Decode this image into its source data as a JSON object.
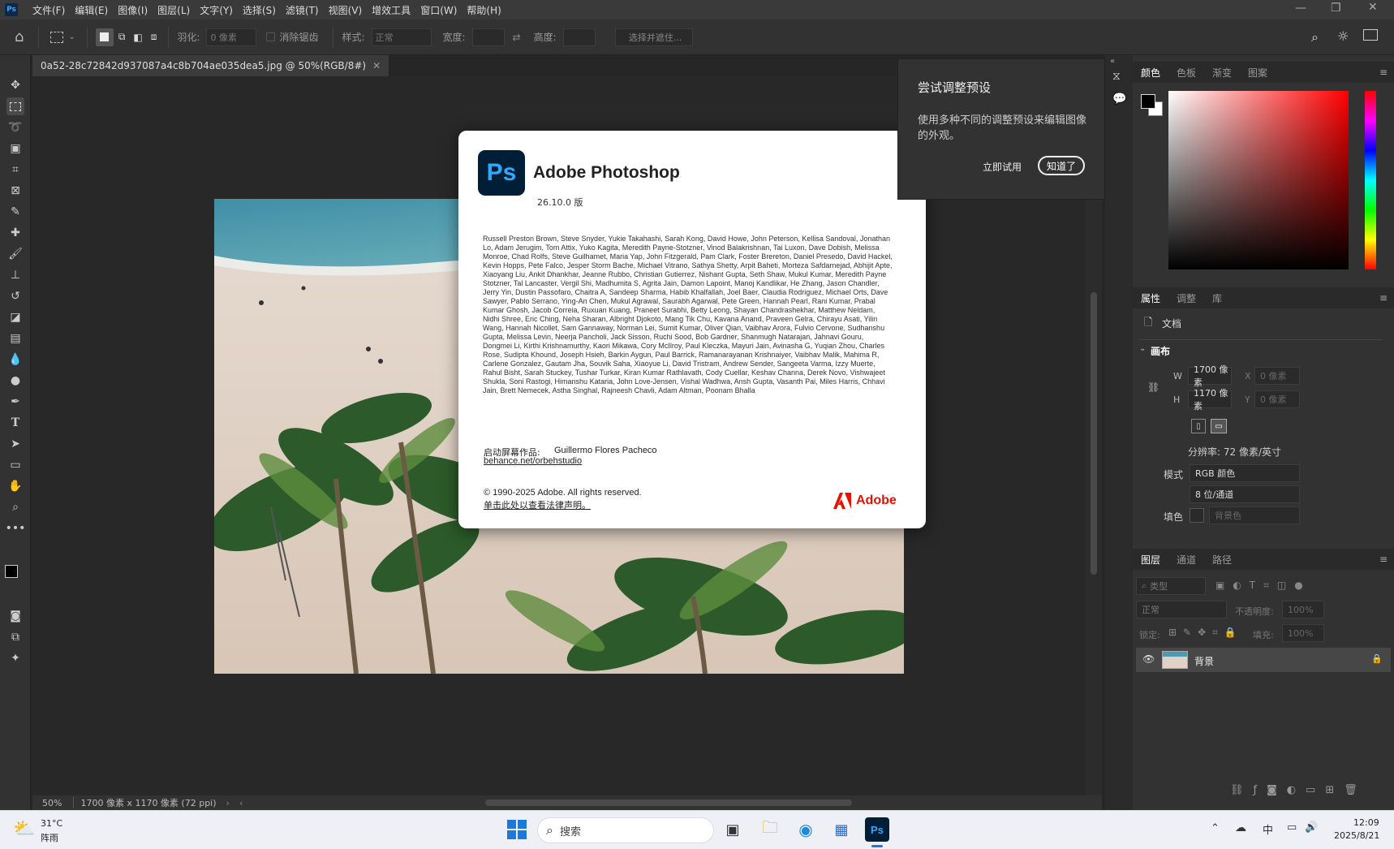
{
  "menubar": {
    "items": [
      "文件(F)",
      "编辑(E)",
      "图像(I)",
      "图层(L)",
      "文字(Y)",
      "选择(S)",
      "滤镜(T)",
      "视图(V)",
      "增效工具",
      "窗口(W)",
      "帮助(H)"
    ]
  },
  "options": {
    "feather_label": "羽化:",
    "feather_value": "0 像素",
    "antialias": "消除锯齿",
    "style_label": "样式:",
    "style_value": "正常",
    "width_label": "宽度:",
    "height_label": "高度:",
    "select_mask": "选择并遮住..."
  },
  "document": {
    "tab_title": "0a52-28c72842d937087a4c8b704ae035dea5.jpg @ 50%(RGB/8#)"
  },
  "status": {
    "zoom": "50%",
    "info": "1700 像素 x 1170 像素 (72 ppi)"
  },
  "about": {
    "product": "Adobe Photoshop",
    "version": "26.10.0 版",
    "credits": "Russell Preston Brown, Steve Snyder, Yukie Takahashi, Sarah Kong, David Howe, John Peterson, Kellisa Sandoval, Jonathan Lo, Adam Jerugim, Tom Attix, Yuko Kagita, Meredith Payne-Stotzner, Vinod Balakrishnan, Tai Luxon, Dave Dobish, Melissa Monroe, Chad Rolfs, Steve Guilhamet, Maria Yap, John Fitzgerald, Pam Clark, Foster Brereton, Daniel Presedo, David Hackel, Kevin Hopps, Pete Falco, Jesper Storm Bache, Michael Vitrano, Sathya Shetty, Arpit Baheti, Morteza Safdarnejad, Abhijit Apte, Xiaoyang Liu, Ankit Dhankhar, Jeanne Rubbo, Christian Gutierrez, Nishant Gupta, Seth Shaw, Mukul Kumar, Meredith Payne Stotzner, Tal Lancaster, Vergil Shi, Madhumita S, Agrita Jain, Damon Lapoint, Manoj Kandlikar, He Zhang, Jason Chandler, Jerry Yin, Dustin Passofaro, Chaitra A, Sandeep Sharma, Habib Khalfallah, Joel Baer, Claudia Rodriguez, Michael Orts, Dave Sawyer, Pablo Serrano, Ying-An Chen, Mukul Agrawal, Saurabh Agarwal, Pete Green, Hannah Pearl, Rani Kumar, Prabal Kumar Ghosh, Jacob Correia, Ruxuan Kuang, Praneet Surabhi, Betty Leong, Shayan Chandrashekhar, Matthew Neldam, Nidhi Shree, Eric Ching, Neha Sharan, Albright Djokoto, Mang Tik Chu, Kavana Anand, Praveen Gelra, Chirayu Asati, Yilin Wang, Hannah Nicollet, Sam Gannaway, Norman Lei, Sumit Kumar, Oliver Qian, Vaibhav Arora, Fulvio Cervone, Sudhanshu Gupta, Melissa Levin, Neerja Pancholi, Jack Sisson, Ruchi Sood, Bob Gardner, Shanmugh Natarajan, Jahnavi Gouru, Dongmei Li, Kirthi Krishnamurthy, Kaori Mikawa, Cory McIlroy, Paul Kleczka, Mayuri Jain, Avinasha G, Yuqian Zhou, Charles Rose, Sudipta Khound, Joseph Hsieh, Barkin Aygun, Paul Barrick, Ramanarayanan Krishnaiyer, Vaibhav Malik, Mahima R, Carlene Gonzalez, Gautam Jha, Souvik Saha, Xiaoyue Li, David Tristram, Andrew Sender, Sangeeta Varma, Izzy Muerte, Rahul Bisht, Sarah Stuckey, Tushar Turkar, Kiran Kumar Rathlavath, Cody Cuellar, Keshav Channa, Derek Novo, Vishwajeet Shukla, Soni Rastogi, Himanshu Kataria, John Love-Jensen, Vishal Wadhwa, Ansh Gupta, Vasanth Pai, Miles Harris, Chhavi Jain, Brett Nemecek, Astha Singhal, Rajneesh Chavli, Adam Altman, Poonam Bhalla",
    "splash_label": "启动屏幕作品:",
    "splash_author": "Guillermo Flores Pacheco",
    "splash_link": "behance.net/orbehstudio",
    "copyright": "© 1990-2025 Adobe. All rights reserved.",
    "legal_link": "单击此处以查看法律声明。",
    "adobe": "Adobe"
  },
  "tooltip": {
    "title": "尝试调整预设",
    "body": "使用多种不同的调整预设来编辑图像的外观。",
    "try_now": "立即试用",
    "got_it": "知道了"
  },
  "color_panel": {
    "tabs": [
      "颜色",
      "色板",
      "渐变",
      "图案"
    ]
  },
  "props_panel": {
    "tabs": [
      "属性",
      "调整",
      "库"
    ],
    "doc_label": "文档",
    "canvas": "画布",
    "w_label": "W",
    "w_value": "1700 像素",
    "h_label": "H",
    "h_value": "1170 像素",
    "x_label": "X",
    "x_value": "0 像素",
    "y_label": "Y",
    "y_value": "0 像素",
    "resolution": "分辨率: 72 像素/英寸",
    "mode_label": "模式",
    "mode_value": "RGB 颜色",
    "depth_value": "8 位/通道",
    "fill_label": "填色",
    "fill_value": "背景色"
  },
  "layers_panel": {
    "tabs": [
      "图层",
      "通道",
      "路径"
    ],
    "filter": "类型",
    "blend": "正常",
    "opacity_label": "不透明度:",
    "opacity_value": "100%",
    "lock_label": "锁定:",
    "fill_label": "填充:",
    "fill_value": "100%",
    "layer_name": "背景"
  },
  "taskbar": {
    "temp": "31°C",
    "weather": "阵雨",
    "search": "搜索",
    "ime": "中",
    "time": "12:09",
    "date": "2025/8/21"
  },
  "colors": {
    "accent": "#31a8ff",
    "ps_bg": "#001e36",
    "adobe_red": "#eb1000"
  }
}
